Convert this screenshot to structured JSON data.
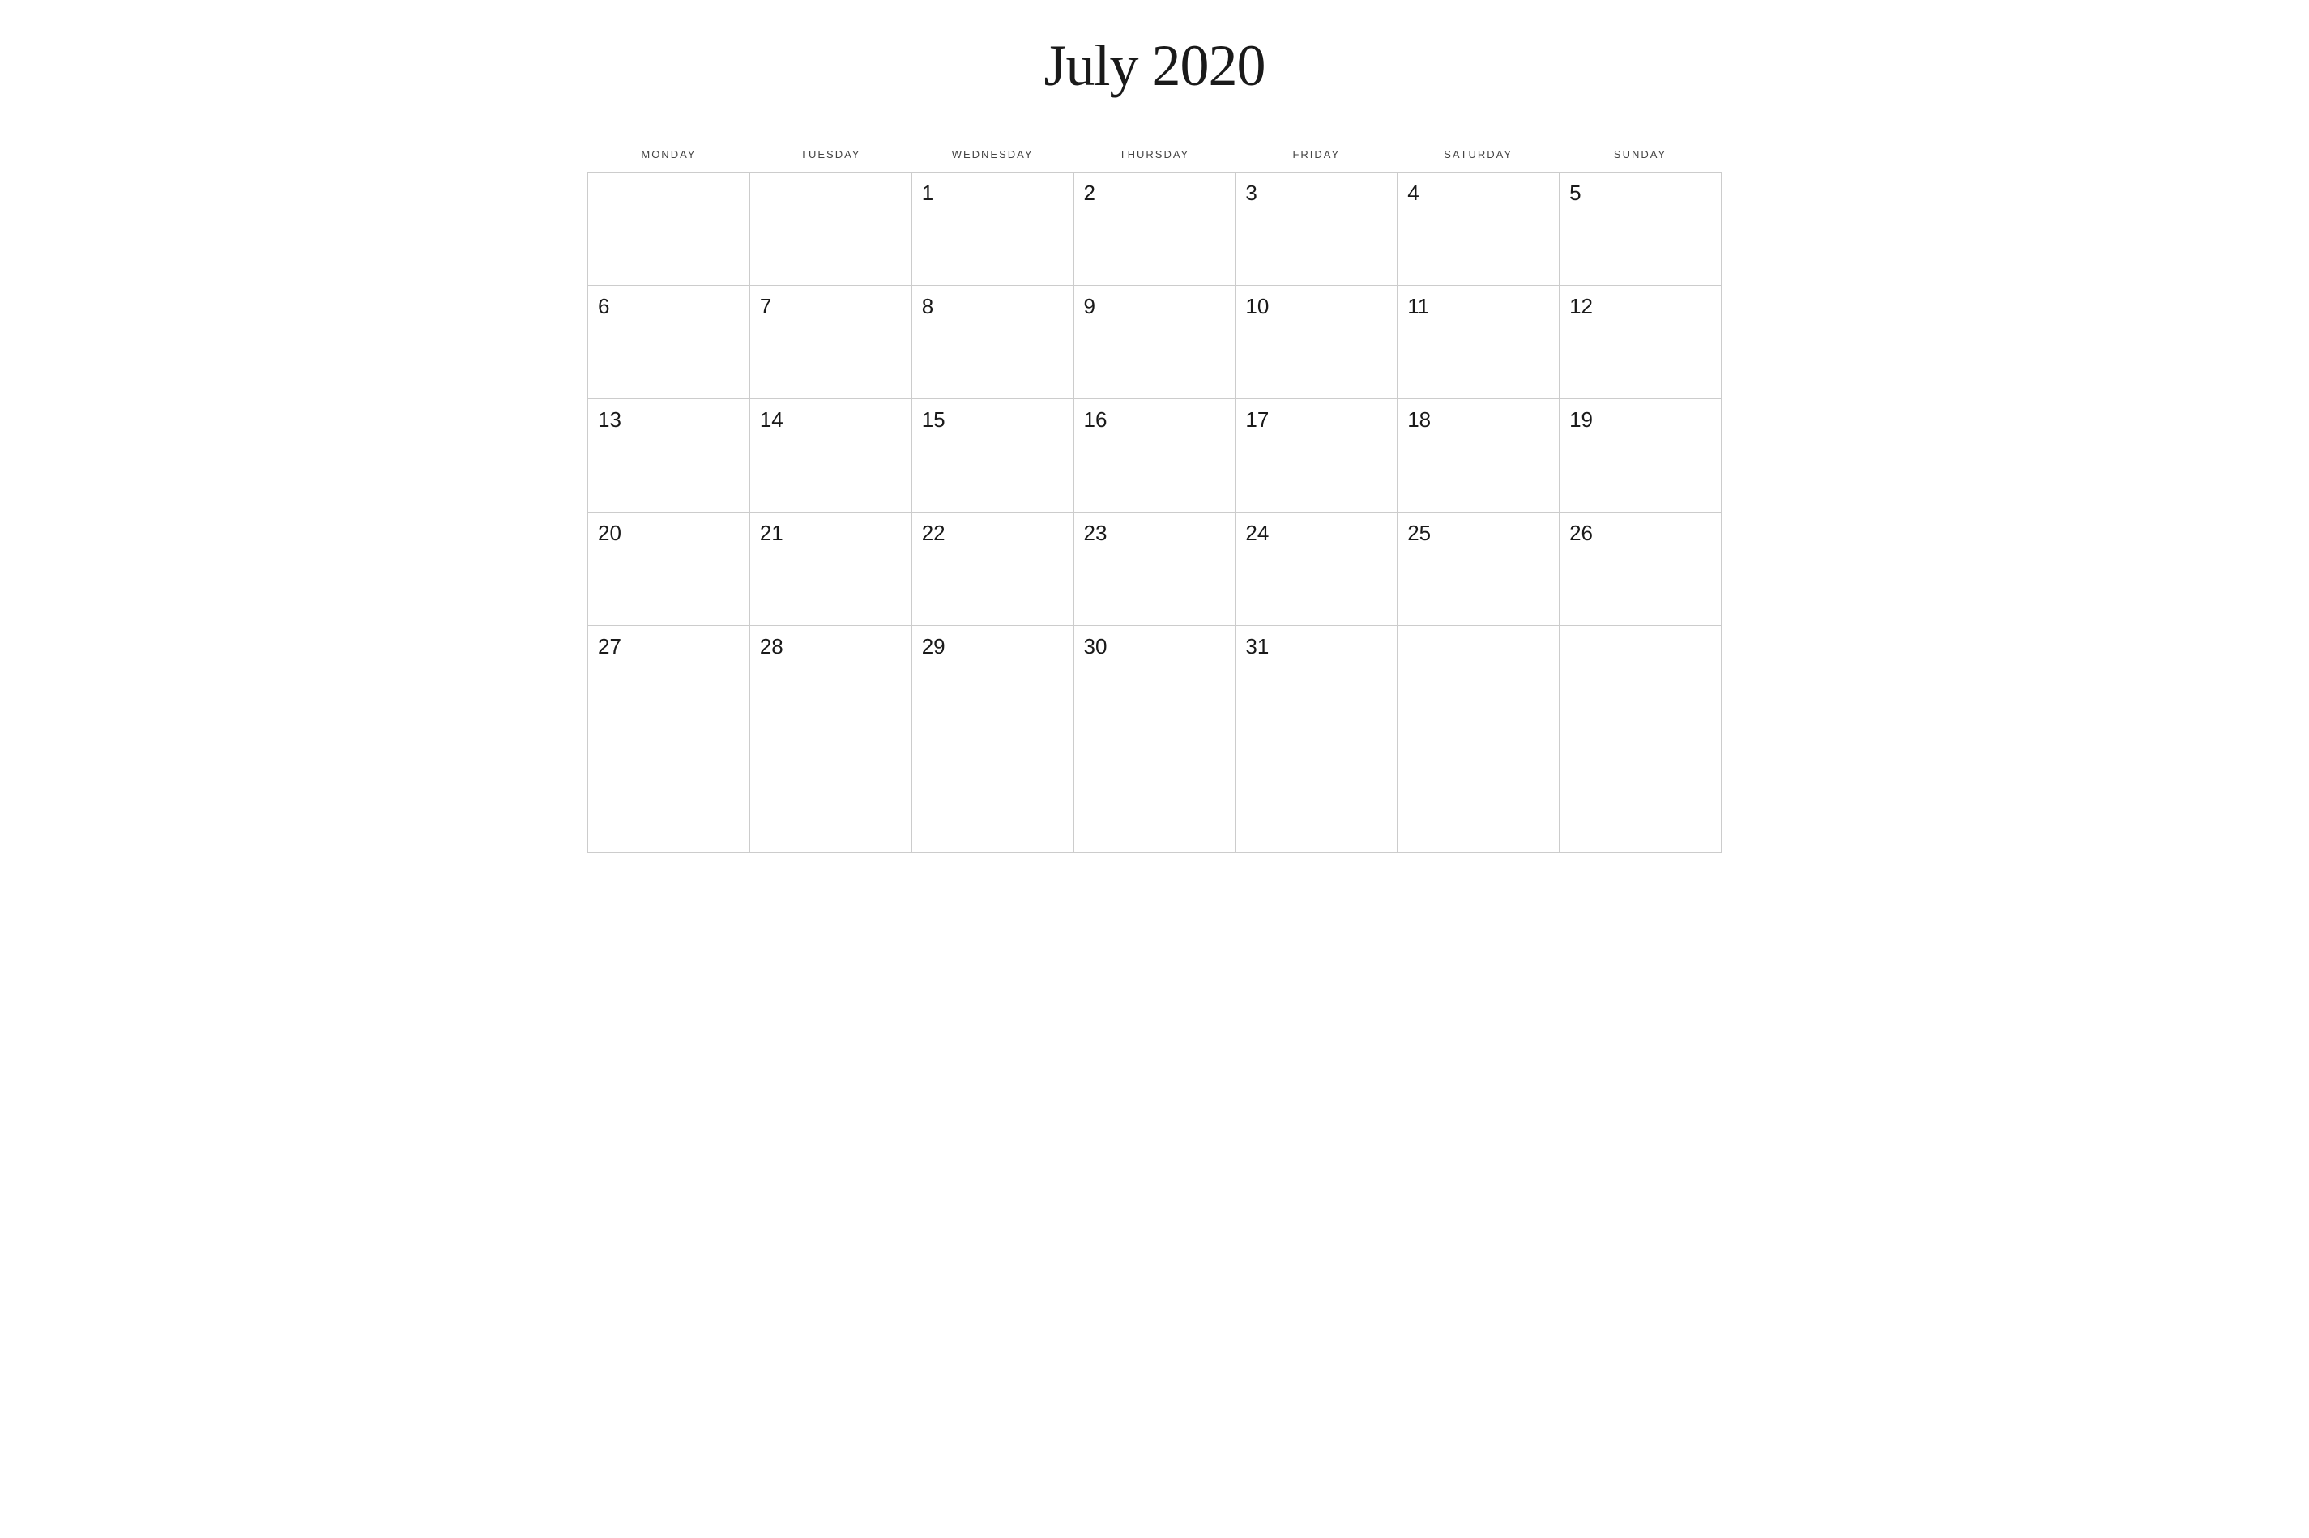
{
  "title": "July 2020",
  "days_of_week": [
    "MONDAY",
    "TUESDAY",
    "WEDNESDAY",
    "THURSDAY",
    "FRIDAY",
    "SATURDAY",
    "SUNDAY"
  ],
  "weeks": [
    [
      null,
      null,
      1,
      2,
      3,
      4,
      5
    ],
    [
      6,
      7,
      8,
      9,
      10,
      11,
      12
    ],
    [
      13,
      14,
      15,
      16,
      17,
      18,
      19
    ],
    [
      20,
      21,
      22,
      23,
      24,
      25,
      26
    ],
    [
      27,
      28,
      29,
      30,
      31,
      null,
      null
    ],
    [
      null,
      null,
      null,
      null,
      null,
      null,
      null
    ]
  ]
}
